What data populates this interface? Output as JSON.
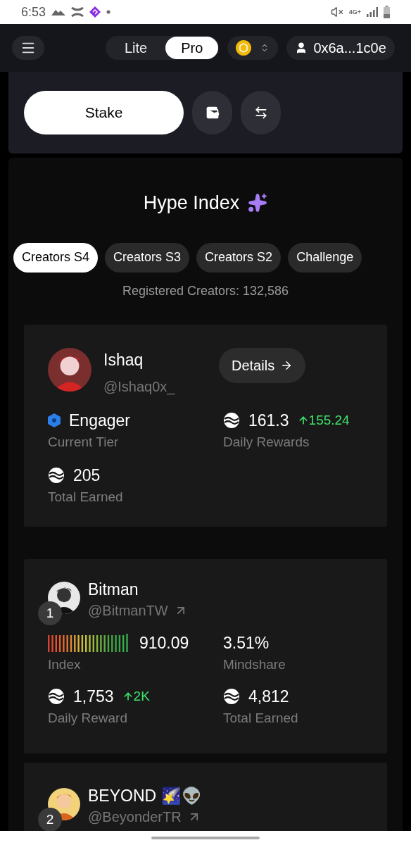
{
  "status_bar": {
    "time": "6:53",
    "network": "4G+"
  },
  "header": {
    "modes": [
      {
        "label": "Lite",
        "selected": false
      },
      {
        "label": "Pro",
        "selected": true
      }
    ],
    "account": "0x6a...1c0e"
  },
  "actions": {
    "stake": "Stake"
  },
  "hype": {
    "title": "Hype Index",
    "tabs": [
      {
        "label": "Creators S4",
        "selected": true
      },
      {
        "label": "Creators S3",
        "selected": false
      },
      {
        "label": "Creators S2",
        "selected": false
      },
      {
        "label": "Challenge",
        "selected": false
      }
    ],
    "registered": "Registered Creators: 132,586"
  },
  "profile": {
    "name": "Ishaq",
    "handle": "@Ishaq0x_",
    "details": "Details",
    "tier": "Engager",
    "tier_label": "Current Tier",
    "daily_rewards": "161.3",
    "daily_change": "155.24",
    "daily_label": "Daily Rewards",
    "total": "205",
    "total_label": "Total Earned"
  },
  "creators": [
    {
      "rank": "1",
      "name": "Bitman",
      "handle": "@BitmanTW",
      "index": "910.09",
      "index_label": "Index",
      "mindshare": "3.51%",
      "mindshare_label": "Mindshare",
      "daily_reward": "1,753",
      "daily_change": "2K",
      "daily_label": "Daily Reward",
      "total": "4,812",
      "total_label": "Total Earned"
    },
    {
      "rank": "2",
      "name": "BEYOND 🌠👽",
      "handle": "@BeyonderTR"
    }
  ]
}
